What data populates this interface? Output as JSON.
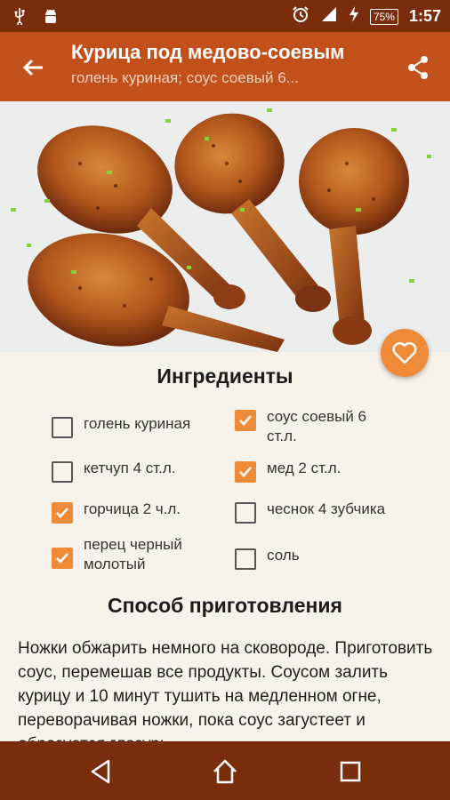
{
  "status_bar": {
    "time": "1:57",
    "battery": "75%"
  },
  "toolbar": {
    "title": "Курица под медово-соевым",
    "subtitle": "голень куриная; соус соевый 6..."
  },
  "ingredients_title": "Ингредиенты",
  "ingredients": [
    {
      "label": "голень куриная",
      "checked": false
    },
    {
      "label": "соус соевый 6 ст.л.",
      "checked": true
    },
    {
      "label": "кетчуп 4 ст.л.",
      "checked": false
    },
    {
      "label": "мед 2 ст.л.",
      "checked": true
    },
    {
      "label": "горчица 2 ч.л.",
      "checked": true
    },
    {
      "label": "чеснок 4 зубчика",
      "checked": false
    },
    {
      "label": "перец черный молотый",
      "checked": true
    },
    {
      "label": "соль",
      "checked": false
    }
  ],
  "method_title": "Способ приготовления",
  "method_text": "Ножки обжарить немного на сковороде. Приготовить соус, перемешав все продукты. Соусом залить курицу и 10 минут тушить на медленном огне, переворачивая ножки, пока соус загустеет и образуется глазурь.",
  "colors": {
    "status_bar": "#7a2d0d",
    "toolbar": "#c2501a",
    "accent": "#ef8a38",
    "background": "#f8f3ea"
  }
}
